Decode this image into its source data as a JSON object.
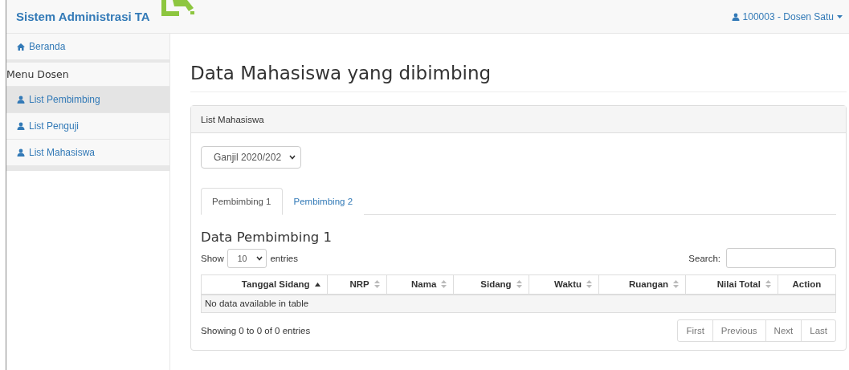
{
  "navbar": {
    "brand": "Sistem Administrasi TA",
    "user": "100003 - Dosen Satu"
  },
  "sidebar": {
    "items": [
      {
        "kind": "home",
        "label": "Beranda",
        "selected": false
      },
      {
        "kind": "header",
        "label": "Menu Dosen"
      },
      {
        "kind": "user",
        "label": "List Pembimbing",
        "selected": true
      },
      {
        "kind": "user",
        "label": "List Penguji",
        "selected": false
      },
      {
        "kind": "user",
        "label": "List Mahasiswa",
        "selected": false
      }
    ]
  },
  "page_title": "Data Mahasiswa yang dibimbing",
  "panel": {
    "heading": "List Mahasiswa",
    "semester": "Ganjil 2020/202",
    "tabs": [
      {
        "label": "Pembimbing 1",
        "selected": true
      },
      {
        "label": "Pembimbing 2",
        "selected": false
      }
    ],
    "section_title": "Data Pembimbing 1",
    "length": {
      "before": "Show",
      "value": "10",
      "after": "entries"
    },
    "search_label": "Search:",
    "table": {
      "columns": [
        {
          "label": "Tanggal Sidang",
          "kind": "sorted"
        },
        {
          "label": "NRP",
          "kind": "sortable"
        },
        {
          "label": "Nama",
          "kind": "sortable"
        },
        {
          "label": "Sidang",
          "kind": "sortable"
        },
        {
          "label": "Waktu",
          "kind": "sortable"
        },
        {
          "label": "Ruangan",
          "kind": "sortable"
        },
        {
          "label": "Nilai Total",
          "kind": "sortable"
        },
        {
          "label": "Action",
          "kind": "plain"
        }
      ],
      "empty": "No data available in table"
    },
    "info": "Showing 0 to 0 of 0 entries",
    "pagination": [
      {
        "label": "First",
        "disabled": true
      },
      {
        "label": "Previous",
        "disabled": true
      },
      {
        "label": "Next",
        "disabled": true
      },
      {
        "label": "Last",
        "disabled": true
      }
    ]
  }
}
